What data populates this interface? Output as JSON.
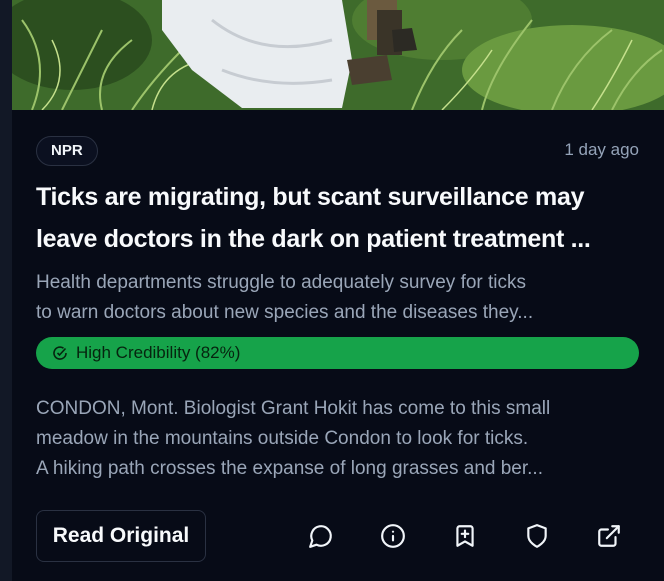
{
  "article": {
    "source": "NPR",
    "time_ago": "1 day ago",
    "title_lines": [
      "Ticks are migrating, but scant surveillance may",
      "leave doctors in the dark on patient treatment ..."
    ],
    "summary_lines": [
      "Health departments struggle to adequately survey for ticks",
      "to warn doctors about new species and the diseases they..."
    ],
    "credibility": {
      "label": "High Credibility (82%)",
      "percent": 82,
      "color": "#16a34a",
      "icon": "check-circle-icon"
    },
    "body_lines": [
      "CONDON, Mont. Biologist Grant Hokit has come to this small",
      "meadow in the mountains outside Condon to look for ticks.",
      "A hiking path crosses the expanse of long grasses and ber..."
    ]
  },
  "actions": {
    "read_original_label": "Read Original",
    "icons": [
      "comment-icon",
      "info-icon",
      "bookmark-add-icon",
      "shield-icon",
      "external-link-icon"
    ]
  },
  "colors": {
    "background": "#070b17",
    "muted_text": "#9aa6b8",
    "accent_green": "#16a34a"
  }
}
